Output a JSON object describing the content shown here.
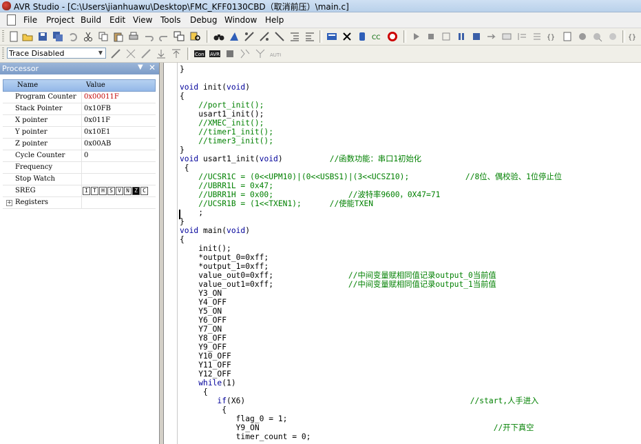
{
  "window": {
    "title": "AVR Studio - [C:\\Users\\jianhuawu\\Desktop\\FMC_KFF0130CBD（取消前压）\\main.c]"
  },
  "menu": [
    "File",
    "Project",
    "Build",
    "Edit",
    "View",
    "Tools",
    "Debug",
    "Window",
    "Help"
  ],
  "toolbar2": {
    "trace_value": "Trace Disabled"
  },
  "processor": {
    "title": "Processor",
    "columns": {
      "name": "Name",
      "value": "Value"
    },
    "rows": [
      {
        "name": "Program Counter",
        "value": "0x00011F",
        "highlight": true
      },
      {
        "name": "Stack Pointer",
        "value": "0x10FB"
      },
      {
        "name": "X pointer",
        "value": "0x011F"
      },
      {
        "name": "Y pointer",
        "value": "0x10E1"
      },
      {
        "name": "Z pointer",
        "value": "0x00AB"
      },
      {
        "name": "Cycle Counter",
        "value": "0"
      },
      {
        "name": "Frequency",
        "value": ""
      },
      {
        "name": "Stop Watch",
        "value": ""
      }
    ],
    "sreg": {
      "name": "SREG",
      "flags": [
        "I",
        "T",
        "H",
        "S",
        "V",
        "N",
        "Z",
        "C"
      ],
      "set": [
        "Z"
      ]
    },
    "registers": {
      "name": "Registers"
    }
  },
  "code": [
    "}",
    "",
    "void init(void)",
    "{",
    "    //port_init();",
    "    usart1_init();",
    "    //XMEC_init();",
    "    //timer1_init();",
    "    //timer3_init();",
    "}",
    "void usart1_init(void)          //函数功能：串口1初始化",
    " {",
    "    //UCSR1C = (0<<UPM10)|(0<<USBS1)|(3<<UCSZ10);            //8位、偶校验、1位停止位",
    "    //UBRR1L = 0x47;",
    "    //UBRR1H = 0x00;                //波特率9600，0X47=71",
    "    //UCSR1B = (1<<TXEN1);      //使能TXEN",
    "    ;",
    "}",
    "void main(void)",
    "{",
    "    init();",
    "    *output_0=0xff;",
    "    *output_1=0xff;",
    "    value_out0=0xff;                //中间变量赋相同值记录output_0当前值",
    "    value_out1=0xff;                //中间变量赋相同值记录output_1当前值",
    "    Y3_ON",
    "    Y4_OFF",
    "    Y5_ON",
    "    Y6_OFF",
    "    Y7_ON",
    "    Y8_OFF",
    "    Y9_OFF",
    "    Y10_OFF",
    "    Y11_OFF",
    "    Y12_OFF",
    "    while(1)",
    "     {",
    "        if(X6)                                                //start,人手进入",
    "         {",
    "            flag_0 = 1;",
    "            Y9_ON                                                  //开下真空",
    "            timer_count = 0;"
  ],
  "colors": {
    "keyword": "#00009a",
    "comment": "#008000",
    "highlight_value": "#c00000"
  }
}
